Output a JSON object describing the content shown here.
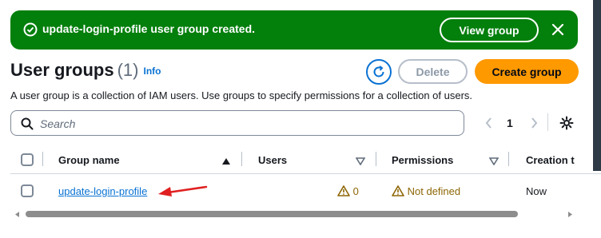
{
  "banner": {
    "message": "update-login-profile user group created.",
    "view_button": "View group",
    "status_color": "#037f0c",
    "icon": "check-circle-icon",
    "close_icon": "close-icon"
  },
  "header": {
    "title": "User groups",
    "count": "(1)",
    "info": "Info",
    "refresh_icon": "refresh-icon",
    "delete_label": "Delete",
    "create_label": "Create group",
    "create_color": "#ff9900"
  },
  "description": "A user group is a collection of IAM users. Use groups to specify permissions for a collection of users.",
  "search": {
    "placeholder": "Search",
    "value": ""
  },
  "pagination": {
    "current_page": "1"
  },
  "table": {
    "columns": [
      "Group name",
      "Users",
      "Permissions",
      "Creation t"
    ],
    "rows": [
      {
        "group_name": "update-login-profile",
        "users": "0",
        "permissions": "Not defined",
        "creation_time": "Now"
      }
    ]
  },
  "annotation": {
    "arrow_color": "#e02020"
  }
}
